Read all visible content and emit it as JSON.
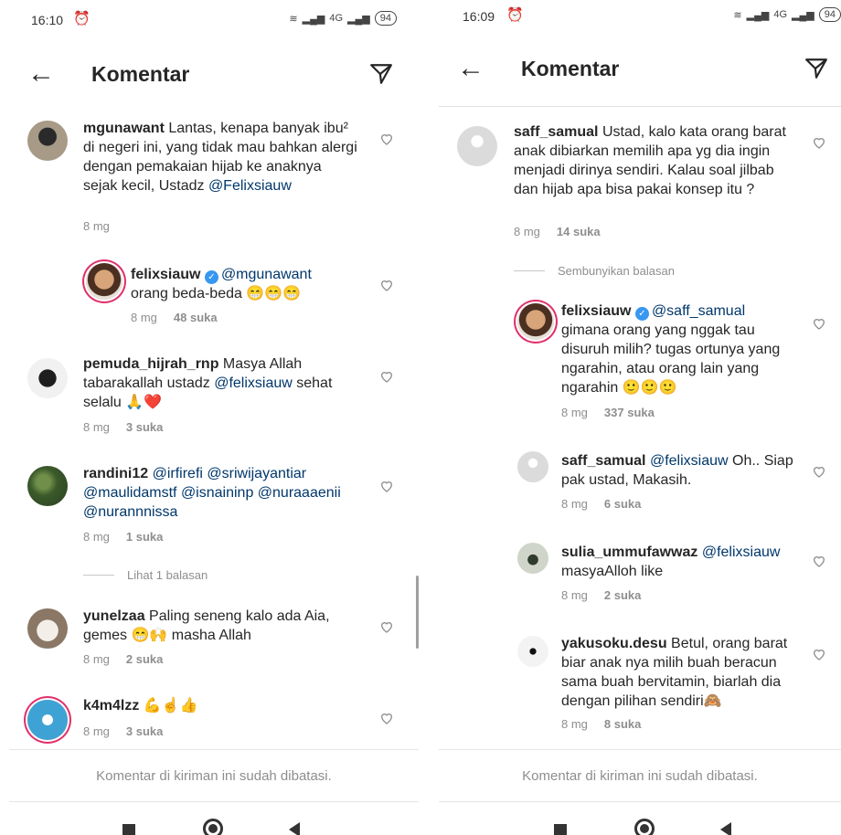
{
  "left": {
    "status": {
      "time": "16:10",
      "battery": "94",
      "network": "4G"
    },
    "header": {
      "title": "Komentar"
    },
    "comments": [
      {
        "user": "mgunawant",
        "text": " Lantas, kenapa banyak ibu² di negeri ini, yang tidak mau bahkan alergi dengan pemakaian hijab ke anaknya sejak kecil, Ustadz ",
        "mention": "@Felixsiauw",
        "time": "8 mg",
        "likes": ""
      },
      {
        "user": "felixsiauw",
        "mention": "@mgunawant",
        "text": "orang beda-beda 😁😁😁",
        "time": "8 mg",
        "likes": "48 suka"
      },
      {
        "user": "pemuda_hijrah_rnp",
        "text": " Masya Allah tabarakallah ustadz ",
        "mention": "@felixsiauw",
        "text2": " sehat selalu 🙏❤️",
        "time": "8 mg",
        "likes": "3 suka"
      },
      {
        "user": "randini12",
        "mentions": "@irfirefi @sriwijayantiar @maulidamstf @isnaininp @nuraaaenii @nurannnissa",
        "time": "8 mg",
        "likes": "1 suka"
      },
      {
        "user": "yunelzaa",
        "text": " Paling seneng kalo ada Aia, gemes 😁🙌 masha Allah",
        "time": "8 mg",
        "likes": "2 suka"
      },
      {
        "user": "k4m4lzz",
        "text": " 💪☝️👍",
        "time": "8 mg",
        "likes": "3 suka"
      }
    ],
    "view_replies": "Lihat 1 balasan",
    "footer": "Komentar di kiriman ini sudah dibatasi."
  },
  "right": {
    "status": {
      "time": "16:09",
      "battery": "94",
      "network": "4G"
    },
    "header": {
      "title": "Komentar"
    },
    "comments": [
      {
        "user": "saff_samual",
        "text": " Ustad, kalo kata orang barat anak dibiarkan memilih apa yg dia ingin menjadi dirinya sendiri. Kalau soal jilbab dan hijab apa bisa pakai konsep itu ?",
        "time": "8 mg",
        "likes": "14 suka"
      },
      {
        "user": "felixsiauw",
        "mention": "@saff_samual",
        "text": "gimana orang yang nggak tau disuruh milih? tugas ortunya yang ngarahin, atau orang lain yang ngarahin 🙂🙂🙂",
        "time": "8 mg",
        "likes": "337 suka"
      },
      {
        "user": "saff_samual",
        "mention": "@felixsiauw",
        "text": " Oh.. Siap pak ustad, Makasih.",
        "time": "8 mg",
        "likes": "6 suka"
      },
      {
        "user": "sulia_ummufawwaz",
        "mention": "@felixsiauw",
        "text": "masyaAlloh like",
        "time": "8 mg",
        "likes": "2 suka"
      },
      {
        "user": "yakusoku.desu",
        "text": " Betul, orang barat biar anak nya milih buah beracun sama buah bervitamin, biarlah dia dengan pilihan sendiri🙈",
        "time": "8 mg",
        "likes": "8 suka"
      }
    ],
    "hide_replies": "Sembunyikan balasan",
    "footer": "Komentar di kiriman ini sudah dibatasi."
  },
  "icons": {
    "back": "arrow-left-icon",
    "filter": "direct-send-icon",
    "heart": "heart-outline-icon",
    "alarm": "alarm-icon",
    "wifi": "wifi-icon",
    "signal": "signal-icon"
  },
  "colors": {
    "mention": "#00376b",
    "verified": "#3897f0",
    "muted": "#8e8e8e"
  }
}
